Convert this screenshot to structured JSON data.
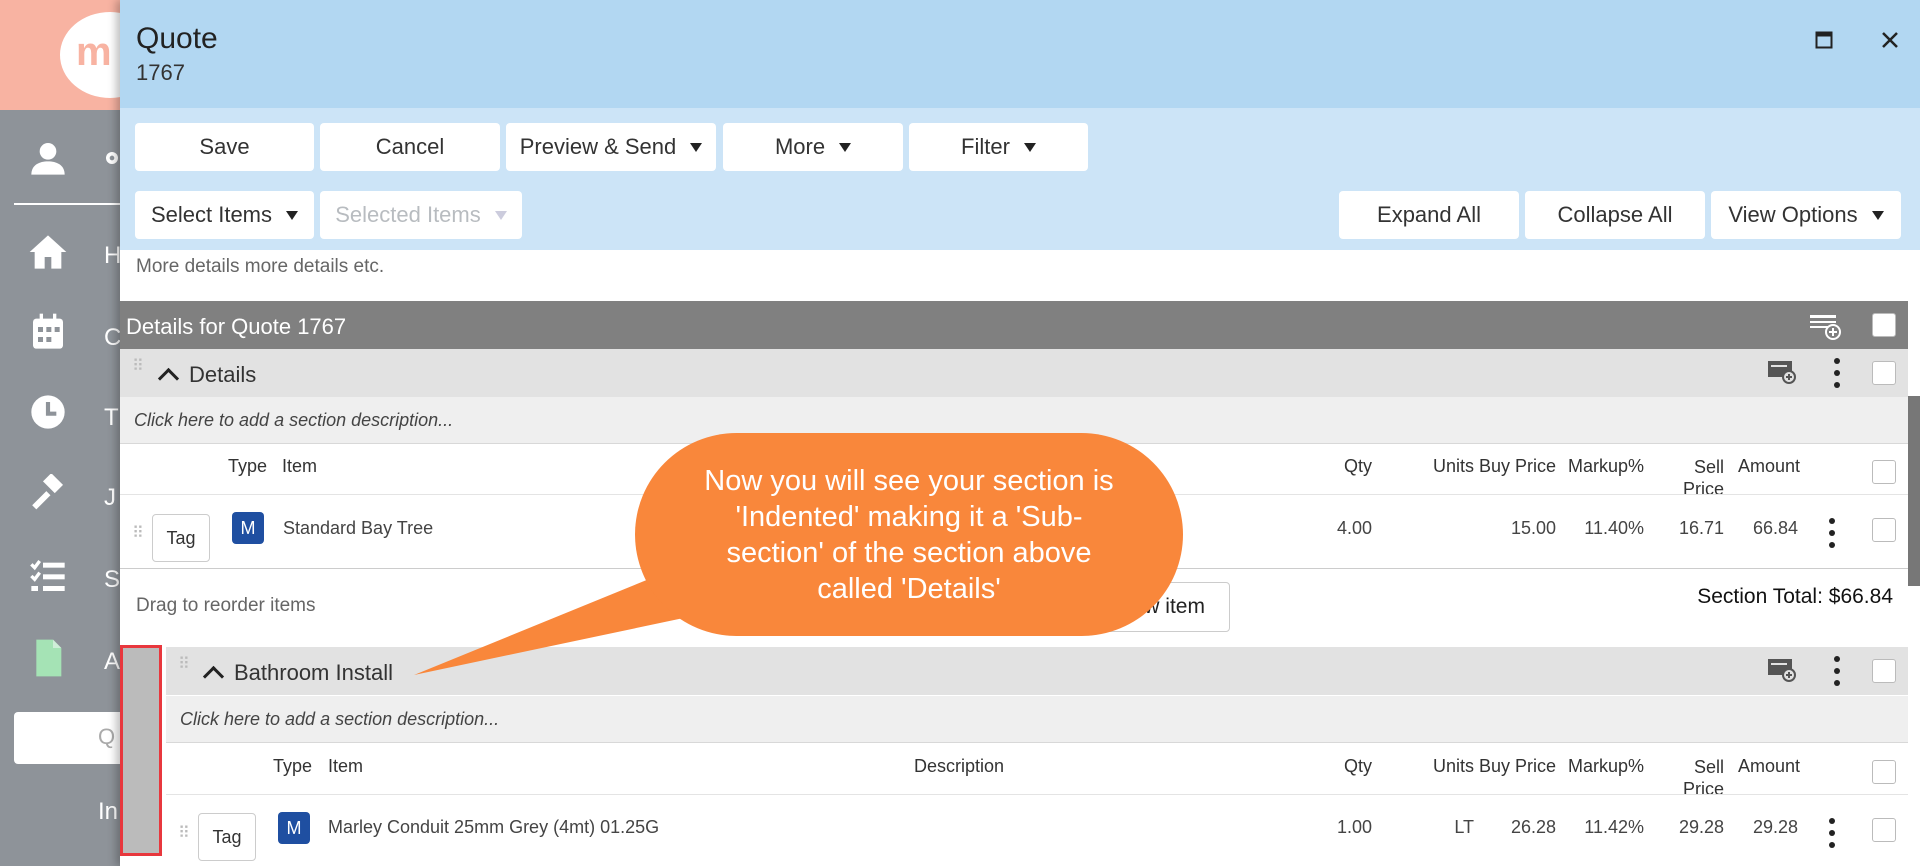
{
  "app": {
    "logo_text": "m",
    "sidebar_letters": [
      "H",
      "C",
      "T",
      "J",
      "S",
      "A"
    ],
    "sidebar_white_item": "Q",
    "sidebar_bottom_text": "In",
    "colors": {
      "top": "#f8b3a2",
      "sidebar": "#8e9399"
    }
  },
  "dialog": {
    "title": "Quote",
    "number": "1767",
    "toolbar_row1": [
      {
        "label": "Save",
        "dropdown": false
      },
      {
        "label": "Cancel",
        "dropdown": false
      },
      {
        "label": "Preview & Send",
        "dropdown": true
      },
      {
        "label": "More",
        "dropdown": true
      },
      {
        "label": "Filter",
        "dropdown": true
      }
    ],
    "select_items_label": "Select Items",
    "selected_items_label": "Selected Items",
    "expand_all_label": "Expand All",
    "collapse_all_label": "Collapse All",
    "view_options_label": "View Options",
    "more_details_text": "More details more details etc.",
    "details_header": "Details for Quote 1767",
    "columns": {
      "type": "Type",
      "item": "Item",
      "description": "Description",
      "qty": "Qty",
      "units": "Units",
      "buy_price": "Buy Price",
      "markup": "Markup%",
      "sell_price": "Sell\nPrice",
      "amount": "Amount"
    },
    "sections": [
      {
        "name": "Details",
        "description_placeholder": "Click here to add a section description...",
        "items": [
          {
            "tag": "Tag",
            "type_badge": "M",
            "item": "Standard Bay Tree",
            "qty": "4.00",
            "units": "",
            "buy_price": "15.00",
            "markup": "11.40%",
            "sell_price": "16.71",
            "amount": "66.84"
          }
        ],
        "drag_note": "Drag to reorder items",
        "add_item_label": "Add a new item",
        "section_total": "Section Total: $66.84"
      },
      {
        "name": "Bathroom Install",
        "description_placeholder": "Click here to add a section description...",
        "items": [
          {
            "tag": "Tag",
            "type_badge": "M",
            "item": "Marley Conduit 25mm Grey (4mt) 01.25G",
            "qty": "1.00",
            "units": "LT",
            "buy_price": "26.28",
            "markup": "11.42%",
            "sell_price": "29.28",
            "amount": "29.28"
          }
        ]
      }
    ]
  },
  "callout": {
    "text": "Now you will see your section is 'Indented' making it a 'Sub-section' of the section above called 'Details'",
    "color": "#f9873b"
  },
  "highlight_color": "#e8373d"
}
